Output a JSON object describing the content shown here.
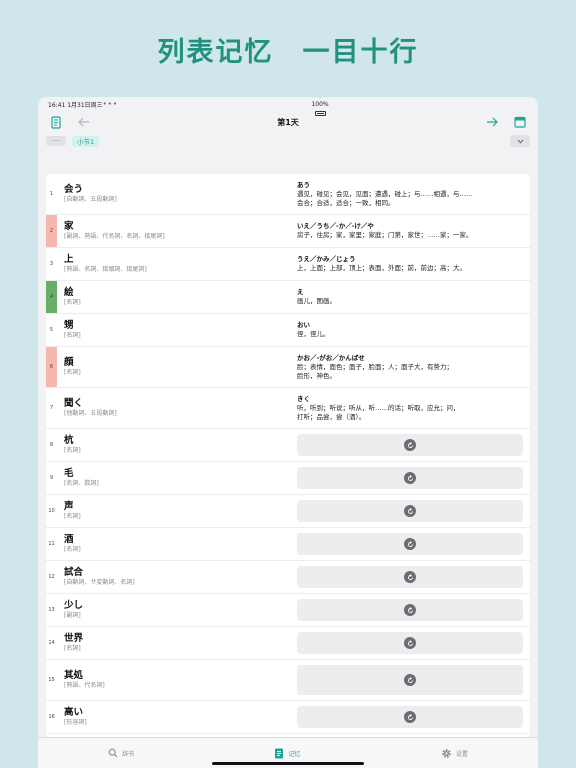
{
  "headline": "列表记忆　一目十行",
  "status": {
    "time": "16:41",
    "date": "1月31日周三",
    "battery": "100%"
  },
  "nav": {
    "title": "第1天"
  },
  "subbar": {
    "more": "···",
    "section": "小节1"
  },
  "words": [
    {
      "n": "1",
      "word": "会う",
      "pos": "[自動詞、五段動詞]",
      "kana": "あう",
      "meaning": [
        "遇见，碰见；会见，见面；遭遇，碰上；与……相遇，与……",
        "会合；合适，适合；一致，相同。"
      ],
      "mark": ""
    },
    {
      "n": "2",
      "word": "家",
      "pos": "[副詞、熟語、代名詞、名詞、接尾詞]",
      "kana": "いえ／うち／-か／-け／や",
      "meaning": [
        "房子，住房；家，家里；家庭；门第，家世；……家；一家。"
      ],
      "mark": "red"
    },
    {
      "n": "3",
      "word": "上",
      "pos": "[熟語、名詞、接頭詞、接尾詞]",
      "kana": "うえ／かみ／じょう",
      "meaning": [
        "上，上面；上部，顶上；表面，外面；前，前边；高；大。"
      ],
      "mark": ""
    },
    {
      "n": "4",
      "word": "絵",
      "pos": "[名詞]",
      "kana": "え",
      "meaning": [
        "画儿，图画。"
      ],
      "mark": "green"
    },
    {
      "n": "5",
      "word": "甥",
      "pos": "[名詞]",
      "kana": "おい",
      "meaning": [
        "侄，侄儿。"
      ],
      "mark": ""
    },
    {
      "n": "6",
      "word": "顔",
      "pos": "[名詞]",
      "kana": "かお／-がお／かんばせ",
      "meaning": [
        "脸；表情，面色；面子，脸面；人；面子大，有势力；",
        "脸形，神色。"
      ],
      "mark": "red"
    },
    {
      "n": "7",
      "word": "聞く",
      "pos": "[他動詞、五段動詞]",
      "kana": "きく",
      "meaning": [
        "听，听到；听说；听从，听……的话；听取，应允；问，",
        "打听；品尝，尝（酒）。"
      ],
      "mark": ""
    },
    {
      "n": "8",
      "word": "杭",
      "pos": "[名詞]",
      "mark": ""
    },
    {
      "n": "9",
      "word": "毛",
      "pos": "[名詞、数詞]",
      "mark": ""
    },
    {
      "n": "10",
      "word": "声",
      "pos": "[名詞]",
      "mark": ""
    },
    {
      "n": "11",
      "word": "酒",
      "pos": "[名詞]",
      "mark": ""
    },
    {
      "n": "12",
      "word": "試合",
      "pos": "[自動詞、サ変動詞、名詞]",
      "mark": ""
    },
    {
      "n": "13",
      "word": "少し",
      "pos": "[副詞]",
      "mark": ""
    },
    {
      "n": "14",
      "word": "世界",
      "pos": "[名詞]",
      "mark": ""
    },
    {
      "n": "15",
      "word": "其処",
      "pos": "[熟語、代名詞]",
      "mark": ""
    },
    {
      "n": "16",
      "word": "高い",
      "pos": "[形容詞]",
      "mark": ""
    }
  ],
  "tabs": [
    {
      "label": "辞书",
      "icon": "search-icon",
      "active": false
    },
    {
      "label": "记忆",
      "icon": "notebook-icon",
      "active": true
    },
    {
      "label": "设置",
      "icon": "gear-icon",
      "active": false
    }
  ],
  "colors": {
    "accent": "#1ea596",
    "headline": "#23917f",
    "mark_red": "#f6b7ad",
    "mark_green": "#6aad69",
    "background": "#cfe6ea"
  }
}
